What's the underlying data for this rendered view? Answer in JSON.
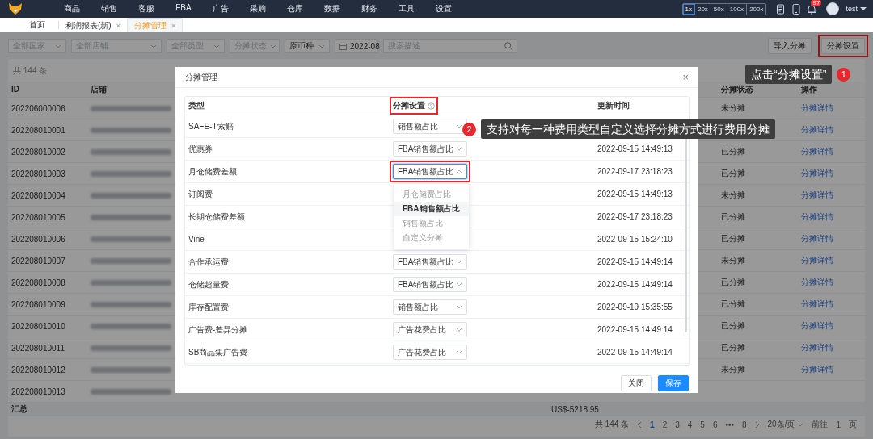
{
  "nav": {
    "menu": [
      "商品",
      "销售",
      "客服",
      "FBA",
      "广告",
      "采购",
      "仓库",
      "数据",
      "财务",
      "工具",
      "设置"
    ],
    "zoom_levels": [
      {
        "label": "1x",
        "selected": true
      },
      {
        "label": "20x",
        "selected": false
      },
      {
        "label": "50x",
        "selected": false
      },
      {
        "label": "100x",
        "selected": false
      },
      {
        "label": "200x",
        "selected": false
      }
    ],
    "notification_count": "97",
    "user": "test"
  },
  "tabs": [
    {
      "label": "首页",
      "selected": false
    },
    {
      "label": "利润报表(新)",
      "selected": false,
      "close": "×"
    },
    {
      "label": "分摊管理",
      "selected": true,
      "close": "×"
    }
  ],
  "filters": [
    {
      "kind": "select",
      "placeholder": "全部国家"
    },
    {
      "kind": "select",
      "placeholder": "全部店铺"
    },
    {
      "kind": "select",
      "placeholder": "全部类型"
    },
    {
      "kind": "select",
      "placeholder": "分摊状态"
    },
    {
      "kind": "select",
      "value": "原币种"
    },
    {
      "kind": "date",
      "value": "2022-08"
    },
    {
      "kind": "search",
      "placeholder": "搜索描述"
    }
  ],
  "actions": [
    {
      "label": "导入分摊"
    },
    {
      "label": "分摊设置",
      "highlighted": true
    }
  ],
  "table": {
    "count": "共 144 条",
    "columns": [
      "ID",
      "店铺",
      "分摊状态",
      "操作"
    ],
    "rows": [
      {
        "id": "202206000006",
        "status": "未分摊",
        "action": "分摊详情"
      },
      {
        "id": "202208010001",
        "action": "分摊详情"
      },
      {
        "id": "202208010002",
        "status": "已分摊",
        "action": "分摊详情"
      },
      {
        "id": "202208010003",
        "status": "已分摊",
        "action": "分摊详情"
      },
      {
        "id": "202208010004",
        "status": "未分摊",
        "action": "分摊详情"
      },
      {
        "id": "202208010005",
        "status": "已分摊",
        "action": "分摊详情"
      },
      {
        "id": "202208010006",
        "status": "已分摊",
        "action": "分摊详情"
      },
      {
        "id": "202208010007",
        "status": "未分摊",
        "action": "分摊详情"
      },
      {
        "id": "202208010008",
        "status": "已分摊",
        "action": "分摊详情"
      },
      {
        "id": "202208010009",
        "status": "已分摊",
        "action": "分摊详情"
      },
      {
        "id": "202208010010",
        "status": "已分摊",
        "action": "分摊详情"
      },
      {
        "id": "202208010011",
        "status": "已分摊",
        "action": "分摊详情"
      },
      {
        "id": "202208010012",
        "status": "未分摊",
        "action": "分摊详情"
      },
      {
        "id": "202208010013"
      }
    ],
    "summary": {
      "label": "汇总",
      "amount": "US$-5218.95"
    }
  },
  "pagination": {
    "total": "共 144 条",
    "pages": [
      {
        "label": "1",
        "selected": true
      },
      {
        "label": "2",
        "selected": false
      },
      {
        "label": "3",
        "selected": false
      },
      {
        "label": "4",
        "selected": false
      },
      {
        "label": "5",
        "selected": false
      },
      {
        "label": "6",
        "selected": false
      },
      {
        "label": "•••",
        "selected": false
      },
      {
        "label": "8",
        "selected": false
      }
    ],
    "page_size": "20条/页",
    "goto_label": "前往",
    "goto_value": "1",
    "page_unit": "页"
  },
  "modal": {
    "title": "分摊管理",
    "close": "×",
    "columns": [
      {
        "label": "类型"
      },
      {
        "label": "分摊设置",
        "help": true,
        "highlighted": true
      },
      {
        "label": "更新时间"
      }
    ],
    "rows": [
      {
        "type": "SAFE-T索赔",
        "method": "销售额占比",
        "open": false
      },
      {
        "type": "优惠券",
        "method": "FBA销售额占比",
        "time": "2022-09-15 14:49:13",
        "open": false
      },
      {
        "type": "月仓储费差额",
        "method": "FBA销售额占比",
        "time": "2022-09-17 23:18:23",
        "open": true,
        "highlighted": true,
        "options": [
          {
            "label": "月仓储费占比",
            "selected": false
          },
          {
            "label": "FBA销售额占比",
            "selected": true
          },
          {
            "label": "销售额占比",
            "selected": false
          },
          {
            "label": "自定义分摊",
            "selected": false
          }
        ]
      },
      {
        "type": "订阅费",
        "time": "2022-09-15 14:49:13"
      },
      {
        "type": "长期仓储费差额",
        "time": "2022-09-17 23:18:23"
      },
      {
        "type": "Vine",
        "time": "2022-09-15 15:24:10"
      },
      {
        "type": "合作承运费",
        "method": "FBA销售额占比",
        "time": "2022-09-15 14:49:14",
        "open": false
      },
      {
        "type": "仓储超量费",
        "method": "FBA销售额占比",
        "time": "2022-09-15 14:49:14",
        "open": false
      },
      {
        "type": "库存配置费",
        "method": "销售额占比",
        "time": "2022-09-19 15:35:55",
        "open": false
      },
      {
        "type": "广告费-差异分摊",
        "method": "广告花费占比",
        "time": "2022-09-15 14:49:14",
        "open": false
      },
      {
        "type": "SB商品集广告费",
        "method": "广告花费占比",
        "time": "2022-09-15 14:49:14",
        "open": false
      }
    ],
    "buttons": [
      {
        "label": "关闭",
        "kind": "default"
      },
      {
        "label": "保存",
        "kind": "primary"
      }
    ]
  },
  "callouts": [
    {
      "number": "1",
      "text": "点击“分摊设置”"
    },
    {
      "number": "2",
      "text": "支持对每一种费用类型自定义选择分摊方式进行费用分摊"
    }
  ]
}
